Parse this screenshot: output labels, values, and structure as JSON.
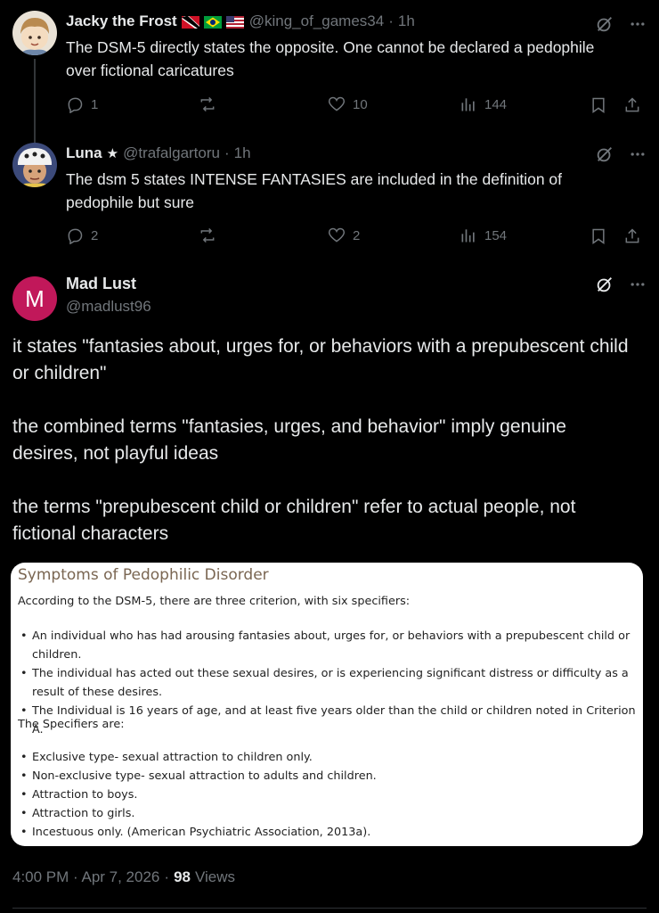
{
  "replies": [
    {
      "name": "Jacky the Frost",
      "flags": [
        "trinidad-and-tobago-flag",
        "brazil-flag",
        "usa-flag"
      ],
      "handle": "@king_of_games34",
      "time": "1h",
      "text": "The DSM-5 directly states the opposite. One cannot be declared a pedophile over fictional caricatures",
      "stats": {
        "replies": "1",
        "reposts": "",
        "likes": "10",
        "views": "144"
      }
    },
    {
      "name": "Luna",
      "name_suffix": "★",
      "handle": "@trafalgartoru",
      "time": "1h",
      "text": "The dsm 5 states INTENSE FANTASIES are included in the definition of pedophile but sure",
      "stats": {
        "replies": "2",
        "reposts": "",
        "likes": "2",
        "views": "154"
      }
    }
  ],
  "sep": "·",
  "main_post": {
    "avatar_letter": "M",
    "avatar_color": "#c1185a",
    "name": "Mad Lust",
    "handle": "@madlust96",
    "paragraphs": [
      "it states \"fantasies about, urges for, or behaviors with a prepubescent child or children\"",
      "the combined terms \"fantasies, urges, and behavior\" imply genuine desires, not playful ideas",
      "the terms \"prepubescent child or children\" refer to actual people, not fictional characters"
    ],
    "image_card": {
      "title": "Symptoms of Pedophilic Disorder",
      "intro": "According to the DSM-5, there are three criterion, with six specifiers:",
      "criteria": [
        "An individual who has had arousing fantasies about, urges for, or behaviors with a prepubescent child or children.",
        "The individual has acted out these sexual desires, or is experiencing significant distress or difficulty as a result of these desires.",
        "The Individual is 16 years of age, and at least five years older than the child or children noted in Criterion A."
      ],
      "specifiers_heading": "The Specifiers are:",
      "specifiers": [
        "Exclusive type- sexual attraction to children only.",
        "Non-exclusive type- sexual attraction to adults and children.",
        "Attraction to boys.",
        "Attraction to girls.",
        "Incestuous only. (American Psychiatric Association, 2013a)."
      ]
    },
    "timestamp": "4:00 PM · Apr 7, 2026",
    "views_count": "98",
    "views_label": "Views"
  },
  "colors": {
    "background": "#000000",
    "text": "#e7e9ea",
    "muted": "#71767b",
    "divider": "#2f3336"
  }
}
